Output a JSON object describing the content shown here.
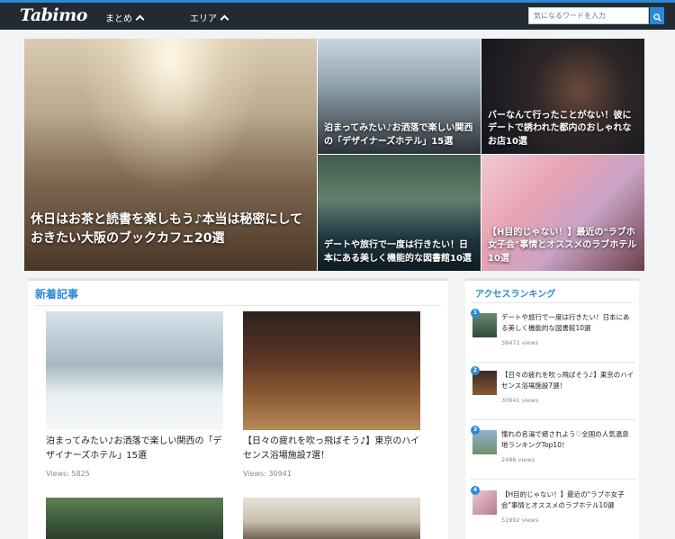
{
  "header": {
    "logo": "Tabimo",
    "nav": [
      "まとめ",
      "エリア"
    ],
    "search_placeholder": "気になるワードを入力"
  },
  "hero": [
    {
      "title": "休日はお茶と読書を楽しもう♪本当は秘密にしておきたい大阪のブックカフェ20選"
    },
    {
      "title": "泊まってみたい♪お洒落で楽しい関西の「デザイナーズホテル」15選"
    },
    {
      "title": "バーなんて行ったことがない！彼にデートで誘われた都内のおしゃれなお店10選"
    },
    {
      "title": "デートや旅行で一度は行きたい！日本にある美しく機能的な図書館10選"
    },
    {
      "title": "【H目的じゃない！】最近の\"ラブホ女子会\"事情とオススメのラブホテル10選"
    }
  ],
  "main": {
    "heading": "新着記事",
    "articles": [
      {
        "title": "泊まってみたい♪お洒落で楽しい関西の「デザイナーズホテル」15選",
        "views": "Views: 5825"
      },
      {
        "title": "【日々の疲れを吹っ飛ばそう♪】東京のハイセンス浴場施設7選！",
        "views": "Views: 30941"
      }
    ]
  },
  "sidebar": {
    "heading": "アクセスランキング",
    "items": [
      {
        "rank": "1",
        "title": "デートや旅行で一度は行きたい！日本にある美しく機能的な図書館10選",
        "views": "38472 views"
      },
      {
        "rank": "2",
        "title": "【日々の疲れを吹っ飛ばそう♪】東京のハイセンス浴場施設7選！",
        "views": "30941 views"
      },
      {
        "rank": "3",
        "title": "憧れの名湯で癒されよう♡全国の人気温泉地ランキングTop10！",
        "views": "2486 views"
      },
      {
        "rank": "4",
        "title": "【H目的じゃない！】最近の\"ラブホ女子会\"事情とオススメのラブホテル10選",
        "views": "51992 views"
      }
    ]
  },
  "colors": {
    "accent": "#2a8ad6",
    "header_bg": "#222b33"
  }
}
